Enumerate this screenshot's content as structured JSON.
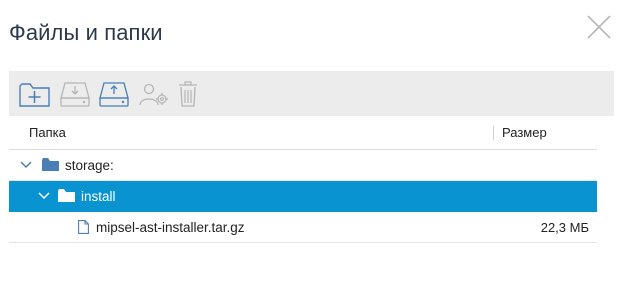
{
  "dialog": {
    "title": "Файлы и папки"
  },
  "toolbar": {
    "buttons": [
      {
        "icon": "new-folder-icon"
      },
      {
        "icon": "download-icon"
      },
      {
        "icon": "upload-icon"
      },
      {
        "icon": "user-settings-icon"
      },
      {
        "icon": "trash-icon"
      }
    ]
  },
  "table": {
    "columns": {
      "name": "Папка",
      "size": "Размер"
    },
    "rows": [
      {
        "name": "storage:",
        "type": "folder",
        "expanded": true,
        "size": "",
        "selected": false
      },
      {
        "name": "install",
        "type": "folder",
        "expanded": true,
        "size": "",
        "selected": true
      },
      {
        "name": "mipsel-ast-installer.tar.gz",
        "type": "file",
        "size": "22,3 МБ",
        "selected": false
      }
    ]
  },
  "colors": {
    "accent": "#0a93d1",
    "folder": "#4a7fb5",
    "toolbar_bg": "#ececec",
    "title": "#2b3a4a"
  }
}
